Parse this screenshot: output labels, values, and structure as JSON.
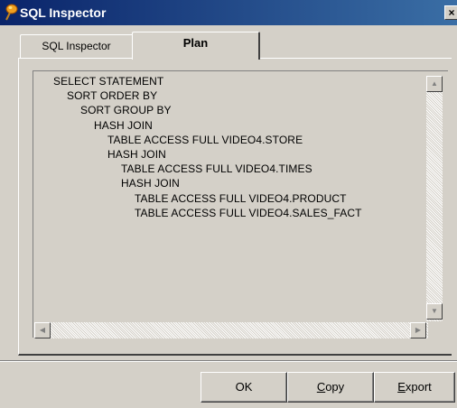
{
  "window": {
    "title": "SQL Inspector",
    "close_glyph": "×",
    "title_icon": "pin-icon"
  },
  "tabs": [
    {
      "label": "SQL Inspector",
      "active": false
    },
    {
      "label": "Plan",
      "active": true
    }
  ],
  "plan": {
    "lines": [
      {
        "text": "SELECT STATEMENT",
        "depth": 0
      },
      {
        "text": "SORT ORDER BY",
        "depth": 1
      },
      {
        "text": "SORT GROUP BY",
        "depth": 2
      },
      {
        "text": "HASH JOIN",
        "depth": 3
      },
      {
        "text": "TABLE ACCESS FULL VIDEO4.STORE",
        "depth": 4
      },
      {
        "text": "HASH JOIN",
        "depth": 4
      },
      {
        "text": "TABLE ACCESS FULL VIDEO4.TIMES",
        "depth": 5
      },
      {
        "text": "HASH JOIN",
        "depth": 5
      },
      {
        "text": "TABLE ACCESS FULL VIDEO4.PRODUCT",
        "depth": 6
      },
      {
        "text": "TABLE ACCESS FULL VIDEO4.SALES_FACT",
        "depth": 6
      }
    ]
  },
  "scrollbars": {
    "up": "▲",
    "down": "▼",
    "left": "◀",
    "right": "▶"
  },
  "buttons": {
    "ok": "OK",
    "copy_mnemonic": "C",
    "copy_rest": "opy",
    "export_mnemonic": "E",
    "export_rest": "xport"
  },
  "colors": {
    "titlebar_start": "#0a246a",
    "titlebar_end": "#3a6ea5",
    "face": "#d4d0c8"
  }
}
